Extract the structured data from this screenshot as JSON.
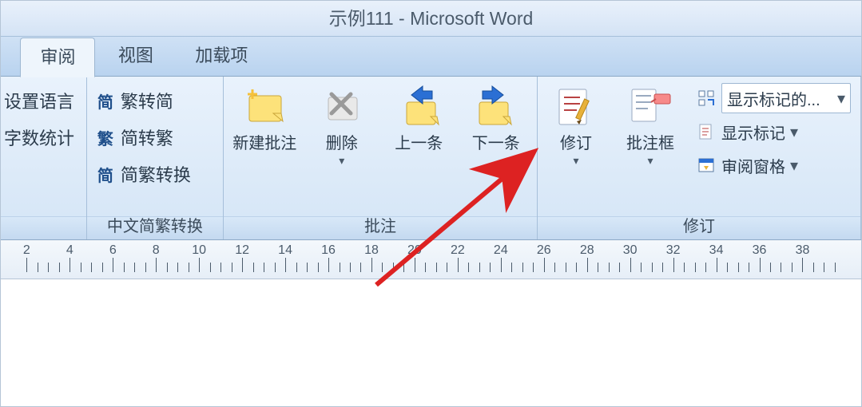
{
  "title": "示例111 - Microsoft Word",
  "tabs": {
    "review": "审阅",
    "view": "视图",
    "addins": "加载项"
  },
  "group_language": {
    "set_language": "设置语言",
    "word_count": "字数统计"
  },
  "group_chinese": {
    "label": "中文简繁转换",
    "to_simplified": "繁转简",
    "to_traditional": "简转繁",
    "convert": "简繁转换",
    "icon_to_simplified": "简",
    "icon_to_traditional": "繁",
    "icon_convert": "简"
  },
  "group_comments": {
    "label": "批注",
    "new_comment": "新建批注",
    "delete": "删除",
    "previous": "上一条",
    "next": "下一条"
  },
  "group_tracking": {
    "label": "修订",
    "track": "修订",
    "balloons": "批注框",
    "display_for_review": "显示标记的...",
    "show_markup": "显示标记",
    "reviewing_pane": "审阅窗格"
  },
  "ruler_numbers": [
    2,
    4,
    6,
    8,
    10,
    12,
    14,
    16,
    18,
    20,
    22,
    24,
    26,
    28,
    30,
    32,
    34,
    36,
    38
  ],
  "caret": "▾"
}
